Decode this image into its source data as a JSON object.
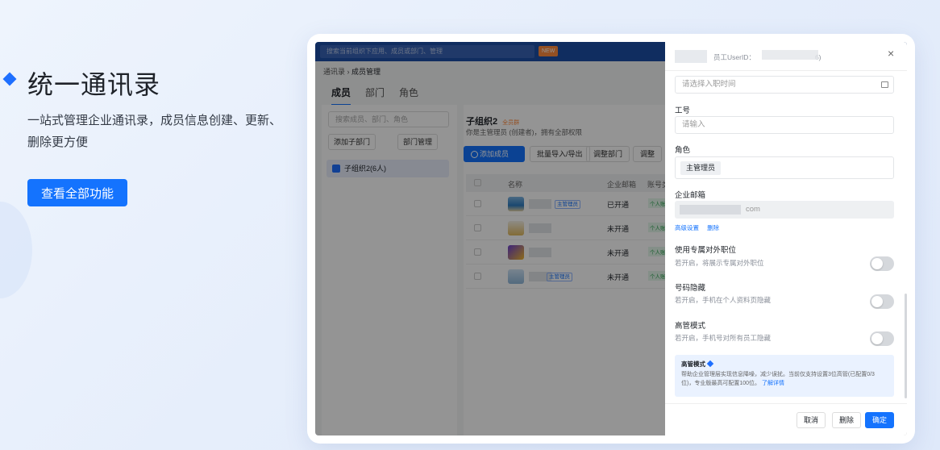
{
  "hero": {
    "title": "统一通讯录",
    "description": "一站式管理企业通讯录，成员信息创建、更新、删除更方便",
    "cta_label": "查看全部功能"
  },
  "app": {
    "top_search_placeholder": "搜索当前组织下应用、成员或部门、管理",
    "new_badge": "NEW",
    "breadcrumb": [
      "通讯录",
      "成员管理"
    ],
    "tabs": [
      "成员",
      "部门",
      "角色"
    ],
    "left": {
      "search_placeholder": "搜索成员、部门、角色",
      "add_subdept": "添加子部门",
      "dept_manage": "部门管理",
      "selected_org": "子组织2(6人)"
    },
    "main": {
      "org_title": "子组织2",
      "org_tag": "全员群",
      "org_desc": "你是主管理员 (创建者)，拥有全部权限",
      "add_member": "添加成员",
      "buttons": [
        "批量导入/导出",
        "调整部门",
        "调整"
      ],
      "columns": [
        "名称",
        "企业邮箱",
        "账号类"
      ],
      "rows": [
        {
          "status": "已开通",
          "tag": "主管理员",
          "ptag": "个人账"
        },
        {
          "status": "未开通",
          "tag": "",
          "ptag": "个人账"
        },
        {
          "status": "未开通",
          "tag": "",
          "ptag": "个人账"
        },
        {
          "status": "未开通",
          "tag": "主管理员",
          "ptag": "个人账"
        }
      ]
    }
  },
  "panel": {
    "id_label": "员工UserID：",
    "id_suffix": "6)",
    "join_date_placeholder": "请选择入职时间",
    "employee_no_label": "工号",
    "employee_no_placeholder": "请输入",
    "role_label": "角色",
    "role_value": "主管理员",
    "email_label": "企业邮箱",
    "email_suffix": "com",
    "email_links": [
      "高级设置",
      "删除"
    ],
    "option1_title": "使用专属对外职位",
    "option1_desc": "若开启，将展示专属对外职位",
    "option2_title": "号码隐藏",
    "option2_desc": "若开启，手机在个人资料页隐藏",
    "option3_title": "高管模式",
    "option3_desc": "若开启，手机号对所有员工隐藏",
    "info_title": "高管模式",
    "info_desc": "帮助企业管理层实现信息降噪，减少误扰。当前仅支持设置3位高管(已配置0/3位)，专业版最高可配置100位。",
    "info_link": "了解详情",
    "cancel": "取消",
    "delete": "删除",
    "confirm": "确定"
  }
}
